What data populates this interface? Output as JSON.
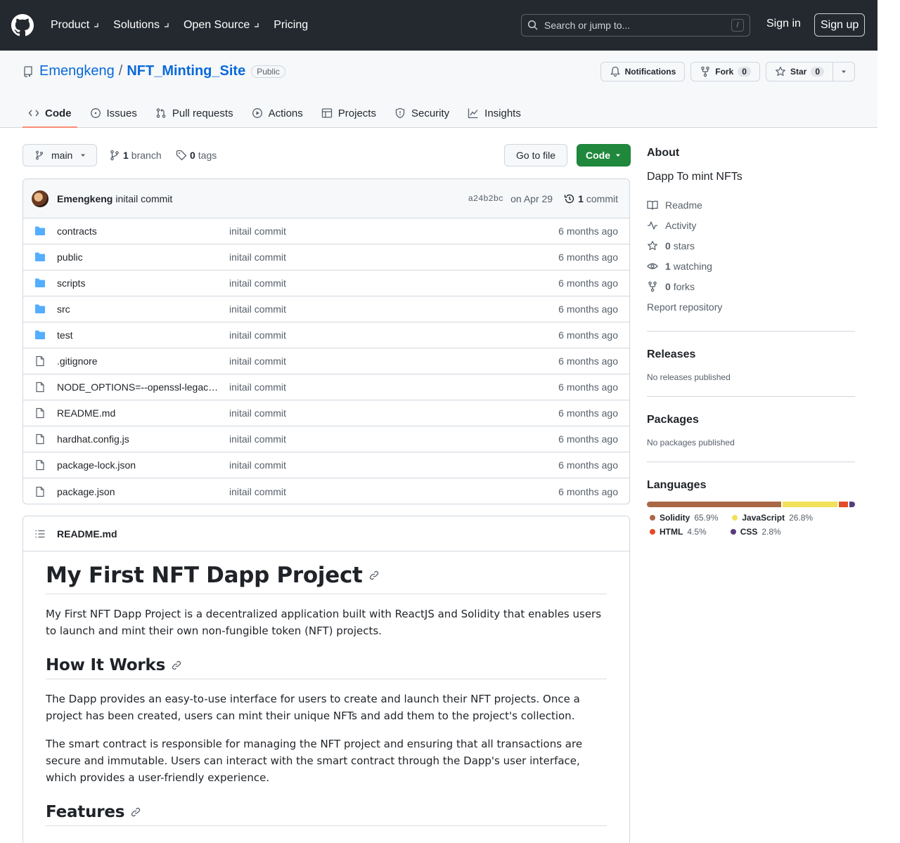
{
  "header": {
    "nav": [
      "Product",
      "Solutions",
      "Open Source",
      "Pricing"
    ],
    "search_placeholder": "Search or jump to...",
    "search_kbd": "/",
    "sign_in": "Sign in",
    "sign_up": "Sign up"
  },
  "repo": {
    "owner": "Emengkeng",
    "slash": "/",
    "name": "NFT_Minting_Site",
    "visibility": "Public",
    "notifications_label": "Notifications",
    "fork_label": "Fork",
    "fork_count": "0",
    "star_label": "Star",
    "star_count": "0"
  },
  "tabs": [
    "Code",
    "Issues",
    "Pull requests",
    "Actions",
    "Projects",
    "Security",
    "Insights"
  ],
  "branchbar": {
    "branch": "main",
    "branch_count": "1",
    "branch_label": "branch",
    "tag_count": "0",
    "tag_label": "tags",
    "go_to_file": "Go to file",
    "code_label": "Code"
  },
  "commit": {
    "author": "Emengkeng",
    "message": "initail commit",
    "sha": "a24b2bc",
    "date": "on Apr 29",
    "count": "1",
    "count_label": "commit"
  },
  "files": [
    {
      "name": "contracts",
      "type": "dir",
      "commit": "initail commit",
      "age": "6 months ago"
    },
    {
      "name": "public",
      "type": "dir",
      "commit": "initail commit",
      "age": "6 months ago"
    },
    {
      "name": "scripts",
      "type": "dir",
      "commit": "initail commit",
      "age": "6 months ago"
    },
    {
      "name": "src",
      "type": "dir",
      "commit": "initail commit",
      "age": "6 months ago"
    },
    {
      "name": "test",
      "type": "dir",
      "commit": "initail commit",
      "age": "6 months ago"
    },
    {
      "name": ".gitignore",
      "type": "file",
      "commit": "initail commit",
      "age": "6 months ago"
    },
    {
      "name": "NODE_OPTIONS=--openssl-legacy-provider",
      "type": "file",
      "commit": "initail commit",
      "age": "6 months ago"
    },
    {
      "name": "README.md",
      "type": "file",
      "commit": "initail commit",
      "age": "6 months ago"
    },
    {
      "name": "hardhat.config.js",
      "type": "file",
      "commit": "initail commit",
      "age": "6 months ago"
    },
    {
      "name": "package-lock.json",
      "type": "file",
      "commit": "initail commit",
      "age": "6 months ago"
    },
    {
      "name": "package.json",
      "type": "file",
      "commit": "initail commit",
      "age": "6 months ago"
    }
  ],
  "readme": {
    "filename": "README.md",
    "h1": "My First NFT Dapp Project",
    "p1": "My First NFT Dapp Project is a decentralized application built with ReactJS and Solidity that enables users to launch and mint their own non-fungible token (NFT) projects.",
    "h2a": "How It Works",
    "p2": "The Dapp provides an easy-to-use interface for users to create and launch their NFT projects. Once a project has been created, users can mint their unique NFTs and add them to the project's collection.",
    "p3": "The smart contract is responsible for managing the NFT project and ensuring that all transactions are secure and immutable. Users can interact with the smart contract through the Dapp's user interface, which provides a user-friendly experience.",
    "h2b": "Features"
  },
  "about": {
    "title": "About",
    "description": "Dapp To mint NFTs",
    "readme": "Readme",
    "activity": "Activity",
    "stars_count": "0",
    "stars_label": "stars",
    "watching_count": "1",
    "watching_label": "watching",
    "forks_count": "0",
    "forks_label": "forks",
    "report": "Report repository"
  },
  "releases": {
    "title": "Releases",
    "empty": "No releases published"
  },
  "packages": {
    "title": "Packages",
    "empty": "No packages published"
  },
  "languages": {
    "title": "Languages",
    "items": [
      {
        "name": "Solidity",
        "percent": "65.9%",
        "value": 65.9,
        "color": "#AA6746"
      },
      {
        "name": "JavaScript",
        "percent": "26.8%",
        "value": 26.8,
        "color": "#f1e05a"
      },
      {
        "name": "HTML",
        "percent": "4.5%",
        "value": 4.5,
        "color": "#e34c26"
      },
      {
        "name": "CSS",
        "percent": "2.8%",
        "value": 2.8,
        "color": "#563d7c"
      }
    ]
  }
}
